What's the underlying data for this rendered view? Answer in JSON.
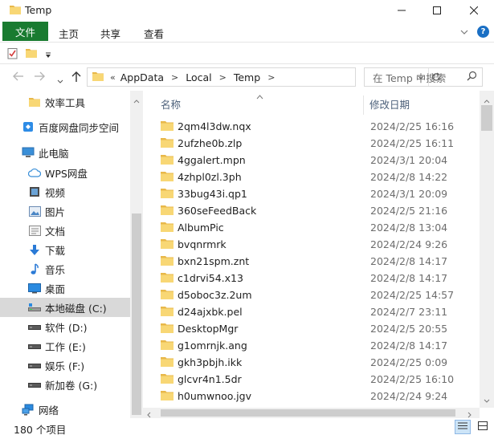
{
  "window": {
    "title": "Temp",
    "minimize_glyph": "—",
    "maximize_glyph": "☐",
    "close_glyph": "✕"
  },
  "ribbon": {
    "file_tab": "文件",
    "tabs": [
      "主页",
      "共享",
      "查看"
    ],
    "help_glyph": "?"
  },
  "address": {
    "lead": "«",
    "crumbs": [
      "AppData",
      "Local",
      "Temp"
    ],
    "separator": ">"
  },
  "search": {
    "placeholder": "在 Temp 中搜索"
  },
  "nav_pane": {
    "items": [
      {
        "label": "效率工具",
        "icon": "folder-icon"
      },
      {
        "label": "百度网盘同步空间",
        "icon": "baidu-sync-icon"
      },
      {
        "label": "此电脑",
        "icon": "computer-icon"
      },
      {
        "label": "WPS网盘",
        "icon": "cloud-icon"
      },
      {
        "label": "视频",
        "icon": "video-icon"
      },
      {
        "label": "图片",
        "icon": "pictures-icon"
      },
      {
        "label": "文档",
        "icon": "documents-icon"
      },
      {
        "label": "下载",
        "icon": "download-icon"
      },
      {
        "label": "音乐",
        "icon": "music-icon"
      },
      {
        "label": "桌面",
        "icon": "desktop-icon"
      },
      {
        "label": "本地磁盘 (C:)",
        "icon": "drive-icon",
        "selected": true
      },
      {
        "label": "软件 (D:)",
        "icon": "drive-icon"
      },
      {
        "label": "工作 (E:)",
        "icon": "drive-icon"
      },
      {
        "label": "娱乐 (F:)",
        "icon": "drive-icon"
      },
      {
        "label": "新加卷 (G:)",
        "icon": "drive-icon"
      },
      {
        "label": "网络",
        "icon": "network-icon"
      }
    ]
  },
  "file_list": {
    "columns": {
      "name": "名称",
      "date_modified": "修改日期"
    },
    "sorted_by": "name",
    "rows": [
      {
        "name": "2qm4l3dw.nqx",
        "date": "2024/2/25 16:16"
      },
      {
        "name": "2ufzhe0b.zlp",
        "date": "2024/2/25 16:11"
      },
      {
        "name": "4ggalert.mpn",
        "date": "2024/3/1 20:04"
      },
      {
        "name": "4zhpl0zl.3ph",
        "date": "2024/2/8 14:22"
      },
      {
        "name": "33bug43i.qp1",
        "date": "2024/3/1 20:09"
      },
      {
        "name": "360seFeedBack",
        "date": "2024/2/5 21:16"
      },
      {
        "name": "AlbumPic",
        "date": "2024/2/8 13:04"
      },
      {
        "name": "bvqnrmrk",
        "date": "2024/2/24 9:26"
      },
      {
        "name": "bxn21spm.znt",
        "date": "2024/2/8 14:17"
      },
      {
        "name": "c1drvi54.x13",
        "date": "2024/2/8 14:17"
      },
      {
        "name": "d5oboc3z.2um",
        "date": "2024/2/25 14:57"
      },
      {
        "name": "d24ajxbk.pel",
        "date": "2024/2/7 23:11"
      },
      {
        "name": "DesktopMgr",
        "date": "2024/2/5 20:55"
      },
      {
        "name": "g1omrnjk.ang",
        "date": "2024/2/8 14:17"
      },
      {
        "name": "gkh3pbjh.ikk",
        "date": "2024/2/25 0:09"
      },
      {
        "name": "glcvr4n1.5dr",
        "date": "2024/2/25 16:10"
      },
      {
        "name": "h0umwnoo.jgv",
        "date": "2024/2/24 9:24"
      }
    ]
  },
  "status": {
    "item_count": "180 个项目"
  },
  "colors": {
    "file_tab_bg": "#197b30",
    "folder_yellow": "#f8d775",
    "header_text": "#4c607a",
    "selected_nav": "#d9d9d9"
  }
}
